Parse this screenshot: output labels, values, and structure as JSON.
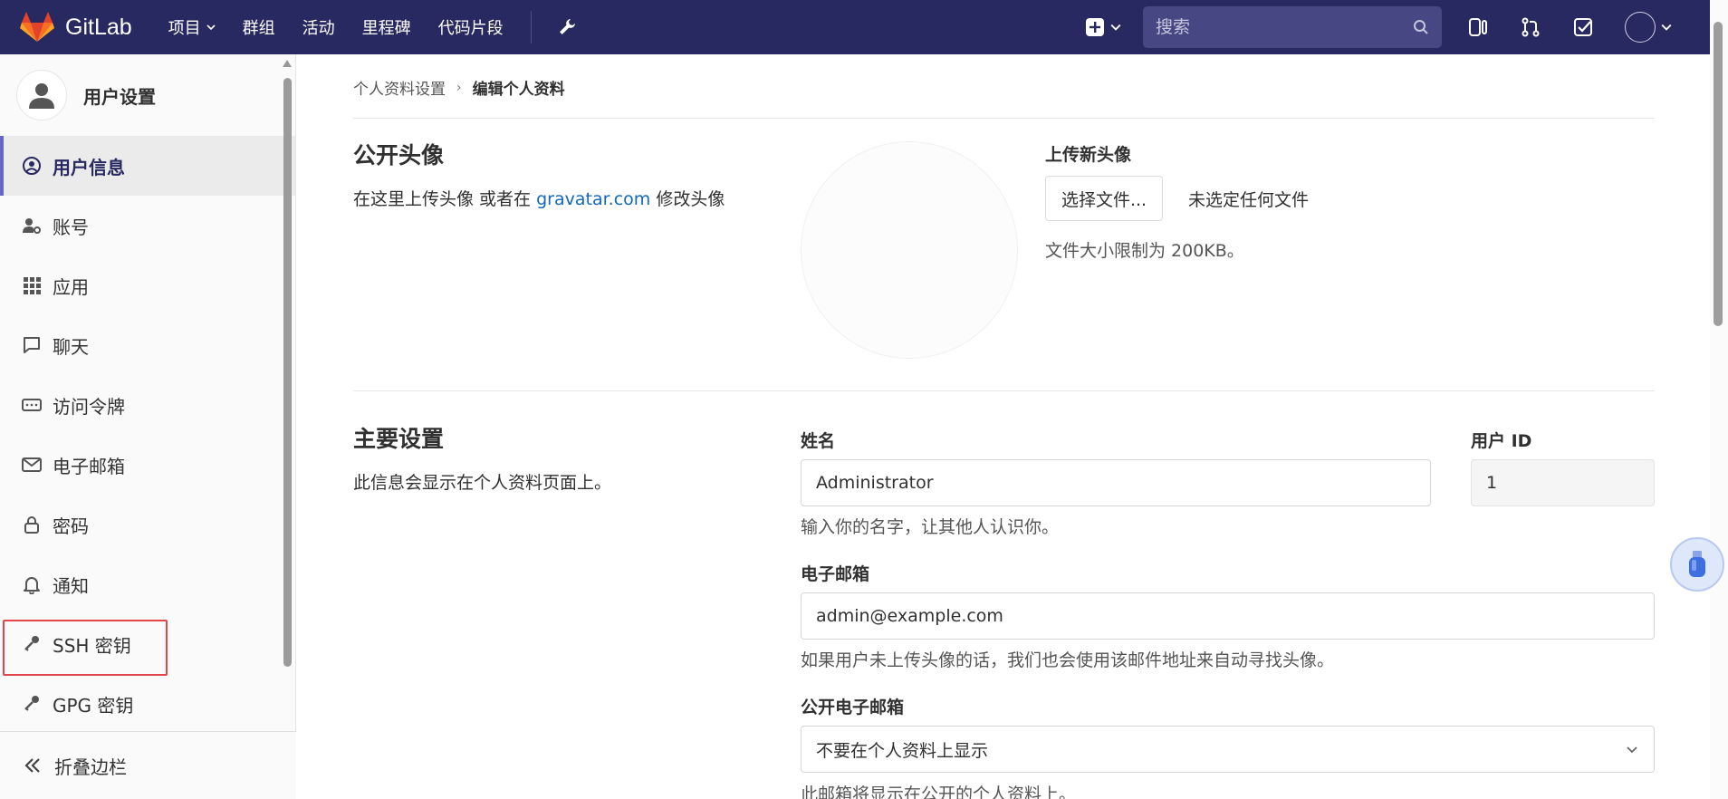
{
  "navbar": {
    "brand": "GitLab",
    "items": [
      {
        "label": "项目",
        "has_dropdown": true
      },
      {
        "label": "群组"
      },
      {
        "label": "活动"
      },
      {
        "label": "里程碑"
      },
      {
        "label": "代码片段"
      }
    ],
    "search_placeholder": "搜索",
    "icons": [
      "wrench-icon",
      "plus-square-icon",
      "search-icon",
      "issues-icon",
      "merge-request-icon",
      "todo-icon",
      "avatar"
    ]
  },
  "sidebar": {
    "title": "用户设置",
    "items": [
      {
        "label": "用户信息",
        "icon": "user-circle-icon",
        "active": true
      },
      {
        "label": "账号",
        "icon": "account-icon"
      },
      {
        "label": "应用",
        "icon": "apps-icon"
      },
      {
        "label": "聊天",
        "icon": "chat-icon"
      },
      {
        "label": "访问令牌",
        "icon": "token-icon"
      },
      {
        "label": "电子邮箱",
        "icon": "mail-icon"
      },
      {
        "label": "密码",
        "icon": "lock-icon"
      },
      {
        "label": "通知",
        "icon": "bell-icon"
      },
      {
        "label": "SSH 密钥",
        "icon": "key-icon",
        "highlighted": true
      },
      {
        "label": "GPG 密钥",
        "icon": "key-icon"
      }
    ],
    "collapse_label": "折叠边栏"
  },
  "breadcrumb": {
    "parent": "个人资料设置",
    "current": "编辑个人资料"
  },
  "avatar_section": {
    "title": "公开头像",
    "desc_prefix": "在这里上传头像 或者在 ",
    "desc_link": "gravatar.com",
    "desc_suffix": " 修改头像",
    "upload_title": "上传新头像",
    "choose_file": "选择文件...",
    "no_file": "未选定任何文件",
    "size_limit": "文件大小限制为 200KB。"
  },
  "main_settings": {
    "title": "主要设置",
    "desc": "此信息会显示在个人资料页面上。",
    "name_label": "姓名",
    "name_value": "Administrator",
    "name_help": "输入你的名字，让其他人认识你。",
    "user_id_label": "用户 ID",
    "user_id_value": "1",
    "email_label": "电子邮箱",
    "email_value": "admin@example.com",
    "email_help": "如果用户未上传头像的话，我们也会使用该邮件地址来自动寻找头像。",
    "public_email_label": "公开电子邮箱",
    "public_email_value": "不要在个人资料上显示",
    "public_email_help": "此邮箱将显示在公开的个人资料上。"
  },
  "colors": {
    "navbar": "#292961",
    "link": "#1068bf",
    "highlight_box": "#e0474c",
    "active_bar": "#6666c4"
  }
}
